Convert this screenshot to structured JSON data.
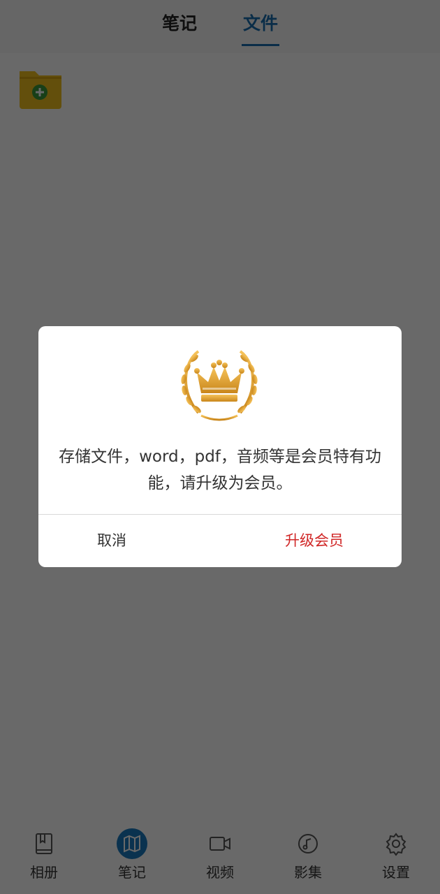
{
  "header": {
    "tabs": [
      {
        "label": "笔记",
        "active": false
      },
      {
        "label": "文件",
        "active": true
      }
    ]
  },
  "main": {
    "add_folder_icon": "folder-add-icon"
  },
  "dialog": {
    "icon": "crown-laurel-icon",
    "message": "存储文件，word，pdf，音频等是会员特有功能，请升级为会员。",
    "cancel_label": "取消",
    "upgrade_label": "升级会员"
  },
  "bottom_nav": {
    "items": [
      {
        "label": "相册",
        "icon": "album-icon",
        "active": false
      },
      {
        "label": "笔记",
        "icon": "map-icon",
        "active": true
      },
      {
        "label": "视频",
        "icon": "video-icon",
        "active": false
      },
      {
        "label": "影集",
        "icon": "music-icon",
        "active": false
      },
      {
        "label": "设置",
        "icon": "gear-icon",
        "active": false
      }
    ]
  },
  "colors": {
    "accent": "#1a6fae",
    "upgrade": "#d02626",
    "gold": "#e0a02a"
  }
}
